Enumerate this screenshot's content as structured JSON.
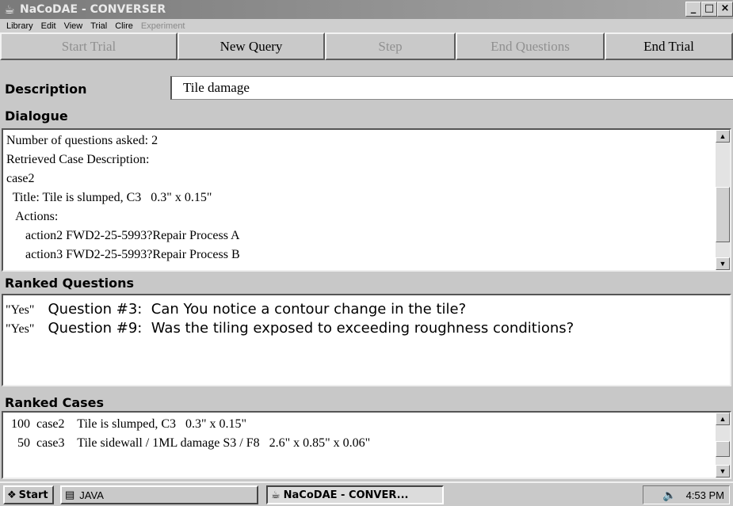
{
  "window": {
    "title": "NaCoDAE - CONVERSER",
    "app_icon": "coffee-cup-icon",
    "buttons": [
      "_",
      "□",
      "×"
    ]
  },
  "menu": {
    "items": [
      "Library",
      "Edit",
      "View",
      "Trial",
      "Clire"
    ],
    "disabled_items": [
      "Experiment"
    ]
  },
  "toolbar": {
    "start_trial": "Start Trial",
    "new_query": "New Query",
    "step": "Step",
    "end_questions": "End Questions",
    "end_trial": "End Trial"
  },
  "description": {
    "label": "Description",
    "value": "Tile damage"
  },
  "dialogue": {
    "label": "Dialogue",
    "lines": [
      "Number of questions asked: 2",
      "Retrieved Case Description:",
      "case2",
      "  Title: Tile is slumped, C3   0.3\" x 0.15\"",
      "   Actions:",
      "      action2 FWD2-25-5993?Repair Process A",
      "      action3 FWD2-25-5993?Repair Process B"
    ]
  },
  "ranked_questions": {
    "label": "Ranked Questions",
    "items": [
      {
        "answer": "\"Yes\"",
        "text": "   Question #3:  Can You notice a contour change in the tile?"
      },
      {
        "answer": "\"Yes\"",
        "text": "   Question #9:  Was the tiling exposed to exceeding roughness conditions?"
      }
    ]
  },
  "ranked_cases": {
    "label": "Ranked Cases",
    "items": [
      "100  case2    Tile is slumped, C3   0.3\" x 0.15\"",
      "  50  case3    Tile sidewall / 1ML damage S3 / F8   2.6\" x 0.85\" x 0.06\""
    ]
  },
  "taskbar": {
    "start": "Start",
    "items": [
      "JAVA",
      "NaCoDAE - CONVER..."
    ],
    "time": "4:53 PM"
  }
}
